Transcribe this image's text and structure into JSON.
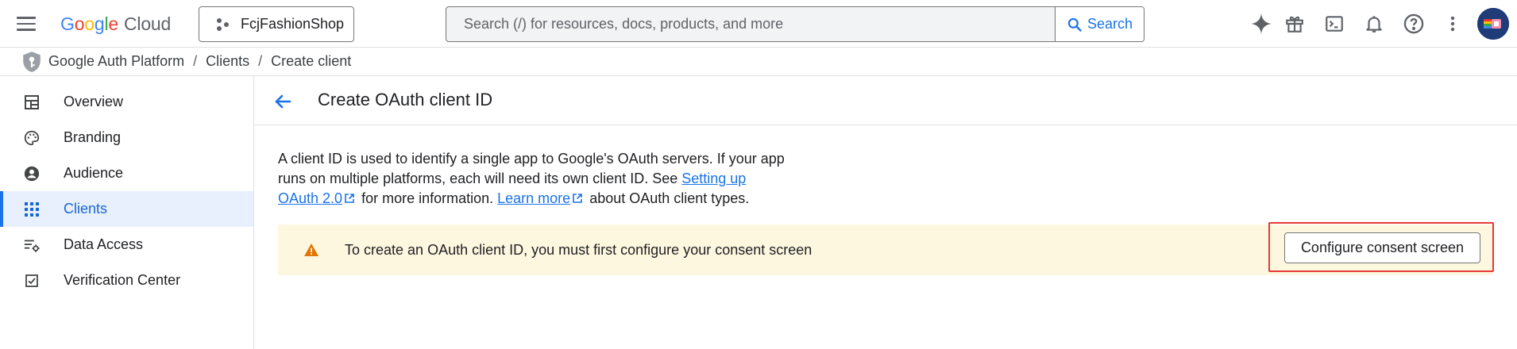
{
  "header": {
    "logo_letters": [
      "G",
      "o",
      "o",
      "g",
      "l",
      "e"
    ],
    "logo_product": "Cloud",
    "project_name": "FcjFashionShop",
    "search_placeholder": "Search (/) for resources, docs, products, and more",
    "search_button_label": "Search",
    "icons": [
      "hamburger-menu-icon",
      "gemini-sparkle-icon",
      "gift-icon",
      "cloud-shell-icon",
      "notifications-bell-icon",
      "help-icon",
      "more-vert-icon",
      "avatar"
    ]
  },
  "breadcrumb": {
    "items": [
      "Google Auth Platform",
      "Clients",
      "Create client"
    ],
    "separator": "/"
  },
  "sidebar": {
    "items": [
      {
        "label": "Overview",
        "icon": "dashboard-icon"
      },
      {
        "label": "Branding",
        "icon": "palette-icon"
      },
      {
        "label": "Audience",
        "icon": "account-circle-icon"
      },
      {
        "label": "Clients",
        "icon": "apps-grid-icon",
        "active": true
      },
      {
        "label": "Data Access",
        "icon": "data-access-icon"
      },
      {
        "label": "Verification Center",
        "icon": "verified-checkbox-icon"
      }
    ]
  },
  "main": {
    "title": "Create OAuth client ID",
    "description": {
      "part1": "A client ID is used to identify a single app to Google's OAuth servers. If your app runs on multiple platforms, each will need its own client ID. See ",
      "link1": "Setting up OAuth 2.0",
      "part2": " for more information. ",
      "link2": "Learn more",
      "part3": " about OAuth client types."
    },
    "warning": {
      "text": "To create an OAuth client ID, you must first configure your consent screen",
      "button_label": "Configure consent screen"
    }
  },
  "colors": {
    "accent": "#1a73e8",
    "active_nav_bg": "#e8f0fe",
    "warning_bg": "#fef7e0",
    "warning_icon": "#e37400",
    "highlight_outline": "#e53935"
  }
}
